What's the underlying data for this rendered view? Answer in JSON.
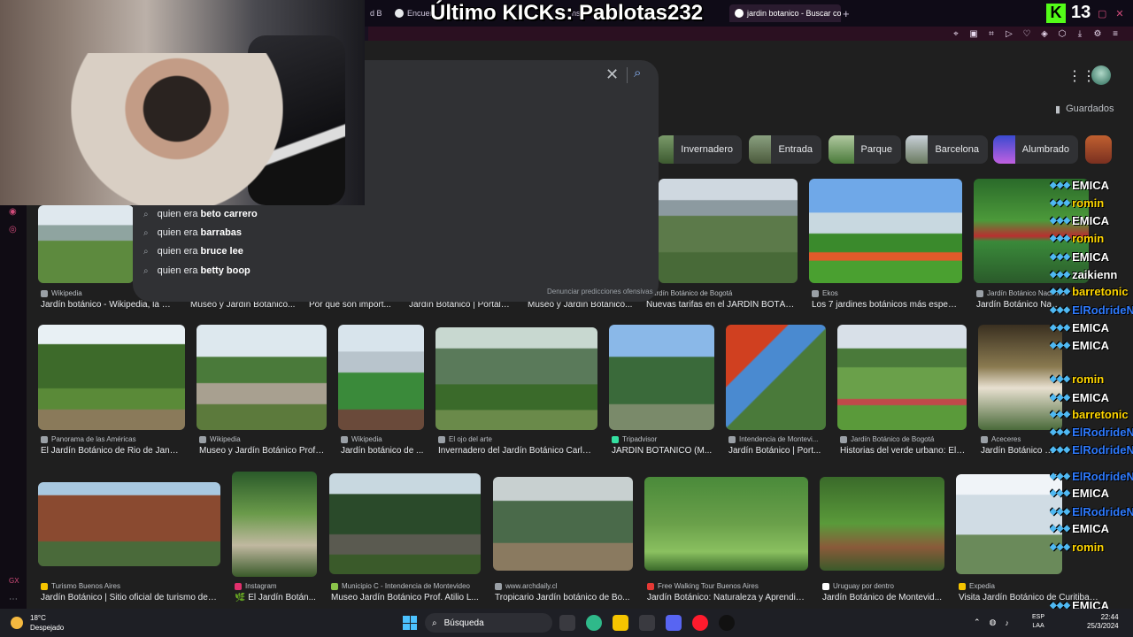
{
  "stream_overlay": {
    "title": "Último KICKs: Pablotas232",
    "kick_logo": "K",
    "viewer_count": "13"
  },
  "browser": {
    "tabs": [
      {
        "label": "d B",
        "active": false
      },
      {
        "label": "Encuent",
        "active": false
      },
      {
        "label": "nsa",
        "active": false
      },
      {
        "label": "jardin botanico - Buscar co",
        "active": true
      }
    ],
    "new_tab": "+",
    "window_buttons": [
      "▢",
      "✕"
    ]
  },
  "search": {
    "clear": "✕",
    "suggestions": [
      {
        "prefix": "quien era ",
        "completion": "beto carrero"
      },
      {
        "prefix": "quien era ",
        "completion": "barrabas"
      },
      {
        "prefix": "quien era ",
        "completion": "bruce lee"
      },
      {
        "prefix": "quien era ",
        "completion": "betty boop"
      }
    ],
    "report": "Denunciar predicciones ofensivas"
  },
  "header": {
    "saved": "Guardados"
  },
  "chips": [
    "Invernadero",
    "Entrada",
    "Parque",
    "Barcelona",
    "Alumbrado"
  ],
  "results": [
    {
      "source": "Wikipedia",
      "title": "Jardín botánico - Wikipedia, la e..."
    },
    {
      "source": "",
      "title": "Museo y Jardín Botánico..."
    },
    {
      "source": "",
      "title": "Por qué son import..."
    },
    {
      "source": "",
      "title": "Jardín Botánico | Portal i..."
    },
    {
      "source": "",
      "title": "Museo y Jardín Botánico..."
    },
    {
      "source": "Jardín Botánico de Bogotá",
      "title": "Nuevas tarifas en el JARDÍN BOTÁN..."
    },
    {
      "source": "Ekos",
      "title": "Los 7 jardines botánicos más espect..."
    },
    {
      "source": "Jardín Botánico Nacional",
      "title": "Jardín Botánico Nacional | JRN..."
    },
    {
      "source": "Panorama de las Américas",
      "title": "El Jardín Botánico de Rio de Janei..."
    },
    {
      "source": "Wikipedia",
      "title": "Museo y Jardín Botánico Profe..."
    },
    {
      "source": "Wikipedia",
      "title": "Jardín botánico de ..."
    },
    {
      "source": "El ojo del arte",
      "title": "Invernadero del Jardín Botánico Carlos..."
    },
    {
      "source": "Tripadvisor",
      "title": "JARDIN BOTANICO (M..."
    },
    {
      "source": "Intendencia de Montevi...",
      "title": "Jardín Botánico | Port..."
    },
    {
      "source": "Jardín Botánico de Bogotá",
      "title": "Historias del verde urbano: El I..."
    },
    {
      "source": "Aceceres",
      "title": "Jardín Botánico de..."
    },
    {
      "source": "Turismo Buenos Aires",
      "title": "Jardín Botánico | Sitio oficial de turismo de l..."
    },
    {
      "source": "Instagram",
      "title": "🌿 El Jardín Botán..."
    },
    {
      "source": "Municipio C - Intendencia de Montevideo",
      "title": "Museo Jardín Botánico Prof. Atilio L..."
    },
    {
      "source": "www.archdaily.cl",
      "title": "Tropicario Jardín botánico de Bo..."
    },
    {
      "source": "Free Walking Tour Buenos Aires",
      "title": "Jardín Botánico: Naturaleza y Aprendiz..."
    },
    {
      "source": "Uruguay por dentro",
      "title": "Jardín Botánico de Montevid..."
    },
    {
      "source": "Expedia",
      "title": "Visita Jardín Botánico de Curitiba en..."
    }
  ],
  "chat": [
    {
      "user": "EMICA",
      "color": "#ffffff"
    },
    {
      "user": "romin",
      "color": "#ffd600"
    },
    {
      "user": "EMICA",
      "color": "#ffffff"
    },
    {
      "user": "romin",
      "color": "#ffd600"
    },
    {
      "user": "EMICA",
      "color": "#ffffff"
    },
    {
      "user": "zaikienn",
      "color": "#ffffff"
    },
    {
      "user": "barretonic",
      "color": "#ffd600"
    },
    {
      "user": "ElRodrideNac",
      "color": "#2f7bff"
    },
    {
      "user": "EMICA",
      "color": "#ffffff"
    },
    {
      "user": "EMICA",
      "color": "#ffffff"
    },
    {
      "user": "romin",
      "color": "#ffd600"
    },
    {
      "user": "EMICA",
      "color": "#ffffff"
    },
    {
      "user": "barretonic",
      "color": "#ffd600"
    },
    {
      "user": "ElRodrideNac",
      "color": "#2f7bff"
    },
    {
      "user": "ElRodrideNac",
      "color": "#2f7bff"
    },
    {
      "user": "ElRodrideNac",
      "color": "#2f7bff"
    },
    {
      "user": "EMICA",
      "color": "#ffffff"
    },
    {
      "user": "ElRodrideNac",
      "color": "#2f7bff"
    },
    {
      "user": "EMICA",
      "color": "#ffffff"
    },
    {
      "user": "romin",
      "color": "#ffd600"
    },
    {
      "user": "EMICA",
      "color": "#ffffff"
    },
    {
      "user": "ElRodrideNac",
      "color": "#2f7bff"
    }
  ],
  "taskbar": {
    "temperature": "18°C",
    "condition": "Despejado",
    "search_label": "Búsqueda",
    "language": "ESP",
    "language_sub": "LAA",
    "time": "22:44",
    "date": "25/3/2024"
  },
  "colors": {
    "accent": "#d14b7a",
    "kick_green": "#53fc18",
    "link_blue": "#8ab4f8"
  }
}
